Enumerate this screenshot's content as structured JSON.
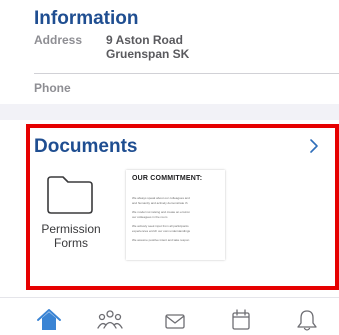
{
  "info": {
    "title": "Information",
    "address_label": "Address",
    "address_line1": "9 Aston Road",
    "address_line2": "Gruenspan SK",
    "phone_label": "Phone"
  },
  "documents": {
    "title": "Documents",
    "items": [
      {
        "type": "folder",
        "icon": "folder-icon",
        "label_line1": "Permission",
        "label_line2": "Forms"
      },
      {
        "type": "document",
        "heading": "OUR COMMITMENT:",
        "bullets": [
          "We always speak about our colleagues and",
          "and humanity and actively demonstrate th",
          "We model not raising and create an environ",
          "our colleagues in the room",
          "We actively seek input from all participants",
          "experiences enrich our own understandings",
          "We assume positive intent and take respon"
        ]
      }
    ]
  },
  "tabbar": {
    "active_color": "#3a84d4",
    "inactive_color": "#6d6d72",
    "tabs": [
      {
        "icon": "home-icon",
        "active": true
      },
      {
        "icon": "people-icon",
        "active": false
      },
      {
        "icon": "mail-icon",
        "active": false
      },
      {
        "icon": "calendar-icon",
        "active": false
      },
      {
        "icon": "bell-icon",
        "active": false
      }
    ]
  },
  "colors": {
    "accent": "#1f4e91",
    "highlight_frame": "#e60000"
  }
}
